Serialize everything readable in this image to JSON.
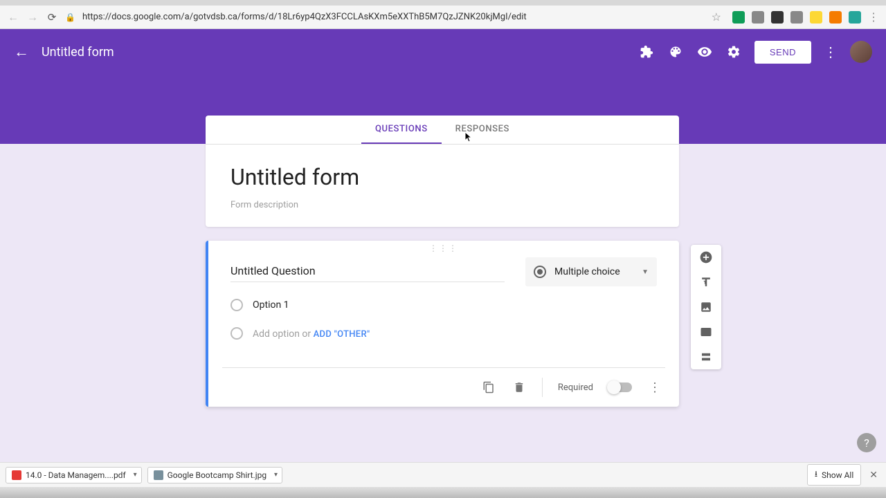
{
  "browser": {
    "url": "https://docs.google.com/a/gotvdsb.ca/forms/d/18Lr6yp4QzX3FCCLAsKXm5eXXThB5M7QzJZNK20kjMgI/edit"
  },
  "header": {
    "form_name": "Untitled form",
    "send_label": "SEND"
  },
  "tabs": {
    "questions": "QUESTIONS",
    "responses": "RESPONSES"
  },
  "form": {
    "title": "Untitled form",
    "description_placeholder": "Form description"
  },
  "question": {
    "title": "Untitled Question",
    "type_label": "Multiple choice",
    "option1": "Option 1",
    "add_option": "Add option",
    "or": " or ",
    "add_other": "ADD \"OTHER\"",
    "required_label": "Required"
  },
  "downloads": {
    "file1": "14.0 - Data Managem....pdf",
    "file2": "Google Bootcamp Shirt.jpg",
    "show_all": "Show All"
  },
  "help": "?"
}
